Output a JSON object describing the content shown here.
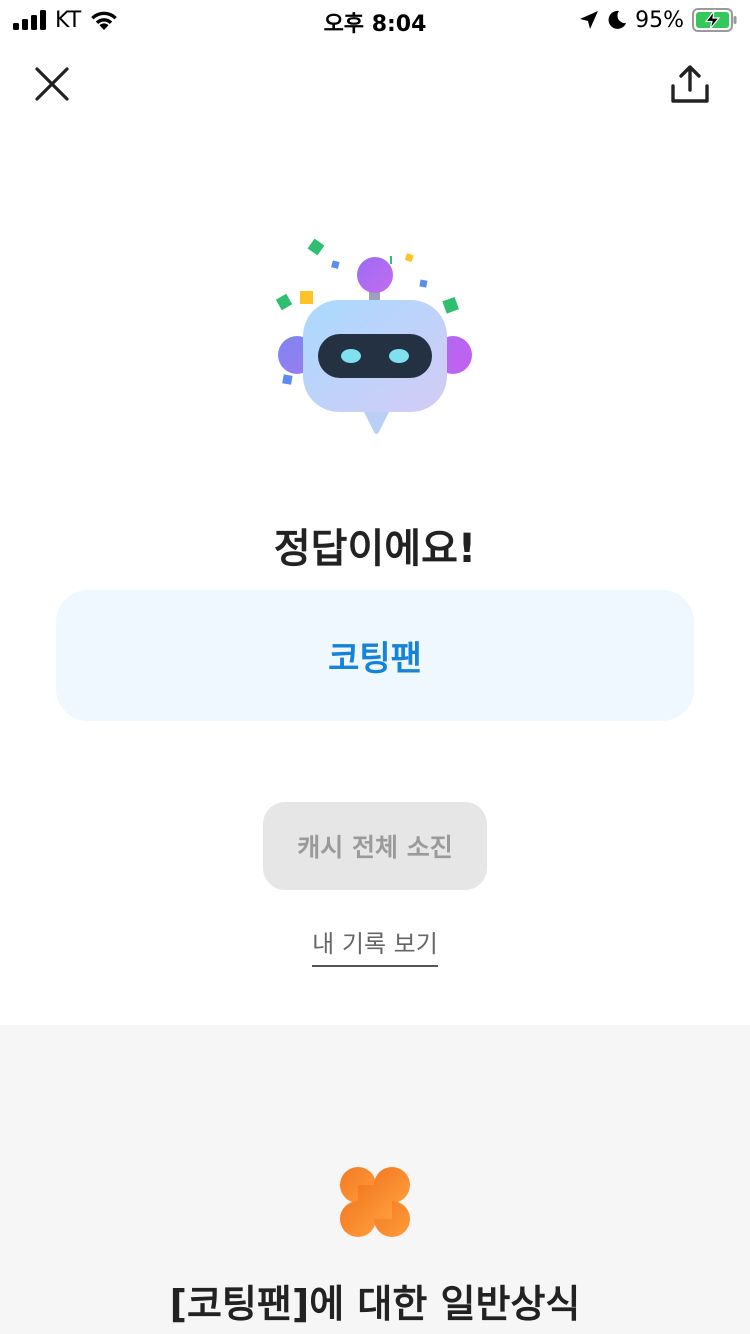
{
  "status_bar": {
    "carrier": "KT",
    "time": "오후 8:04",
    "battery_percent": "95%",
    "icons": [
      "signal-icon",
      "wifi-icon",
      "location-icon",
      "moon-icon",
      "battery-charging-icon"
    ]
  },
  "nav": {
    "close_icon": "close-icon",
    "share_icon": "share-icon"
  },
  "result": {
    "title": "정답이에요!",
    "answer": "코팅팬"
  },
  "actions": {
    "primary_button_label": "캐시 전체 소진",
    "primary_button_disabled": true,
    "record_link_label": "내 기록 보기"
  },
  "info": {
    "title": "[코팅팬]에 대한 일반상식"
  },
  "colors": {
    "accent": "#1683d6",
    "answer_bg": "#f0f8ff",
    "disabled_bg": "#e6e6e6",
    "clover": "#f58a2c"
  }
}
